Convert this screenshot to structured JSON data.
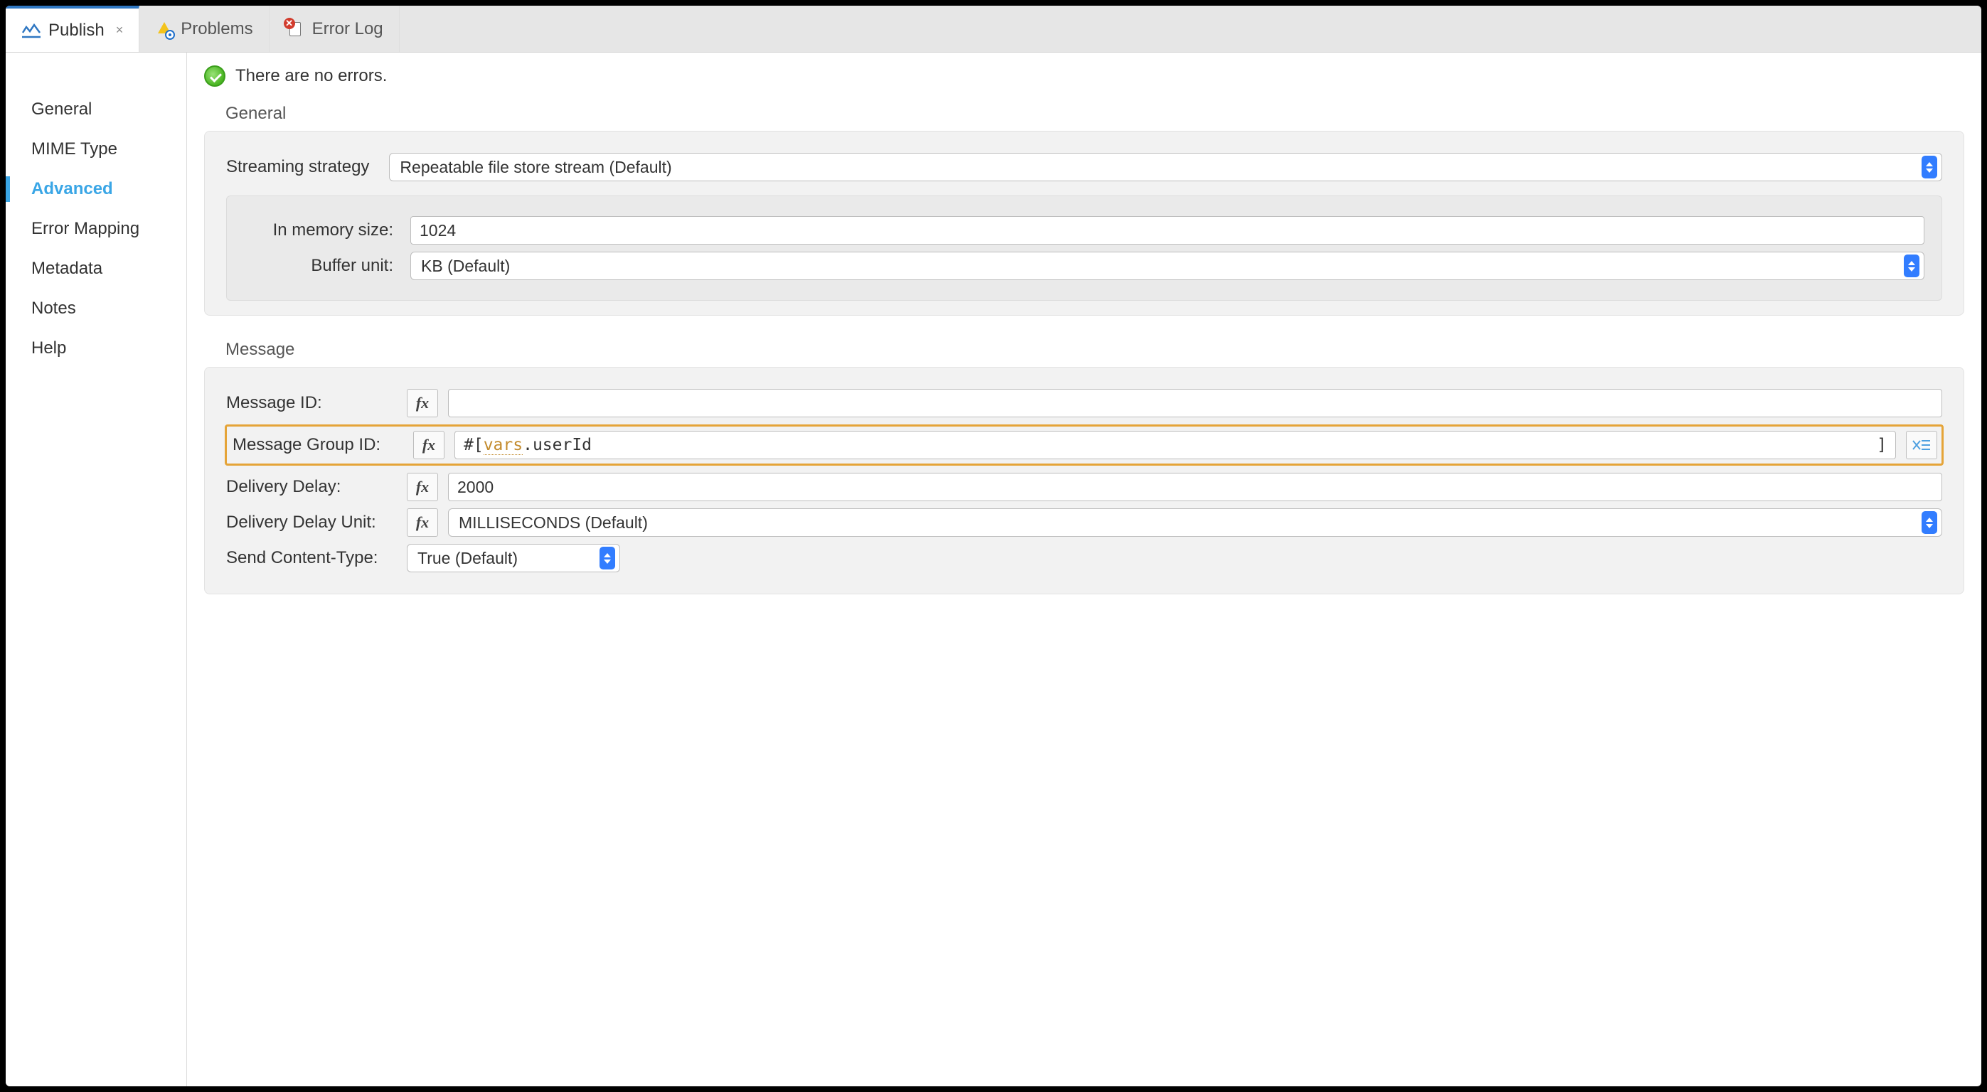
{
  "tabs": {
    "publish": "Publish",
    "problems": "Problems",
    "errorlog": "Error Log",
    "close_glyph": "×"
  },
  "sidebar": {
    "items": [
      {
        "label": "General"
      },
      {
        "label": "MIME Type"
      },
      {
        "label": "Advanced",
        "selected": true
      },
      {
        "label": "Error Mapping"
      },
      {
        "label": "Metadata"
      },
      {
        "label": "Notes"
      },
      {
        "label": "Help"
      }
    ]
  },
  "status": {
    "message": "There are no errors."
  },
  "sections": {
    "general": {
      "title": "General",
      "streaming_strategy": {
        "label": "Streaming strategy",
        "value": "Repeatable file store stream (Default)"
      },
      "in_memory_size": {
        "label": "In memory size:",
        "value": "1024"
      },
      "buffer_unit": {
        "label": "Buffer unit:",
        "value": "KB (Default)"
      }
    },
    "message": {
      "title": "Message",
      "message_id": {
        "label": "Message ID:",
        "value": ""
      },
      "message_group_id": {
        "label": "Message Group ID:",
        "expr_prefix": "#[ ",
        "expr_keyword": "vars",
        "expr_rest": ".userId",
        "expr_close": "]"
      },
      "delivery_delay": {
        "label": "Delivery Delay:",
        "value": "2000"
      },
      "delivery_delay_unit": {
        "label": "Delivery Delay Unit:",
        "value": "MILLISECONDS (Default)"
      },
      "send_content_type": {
        "label": "Send Content-Type:",
        "value": "True (Default)"
      }
    }
  },
  "fx_glyph": "fx"
}
